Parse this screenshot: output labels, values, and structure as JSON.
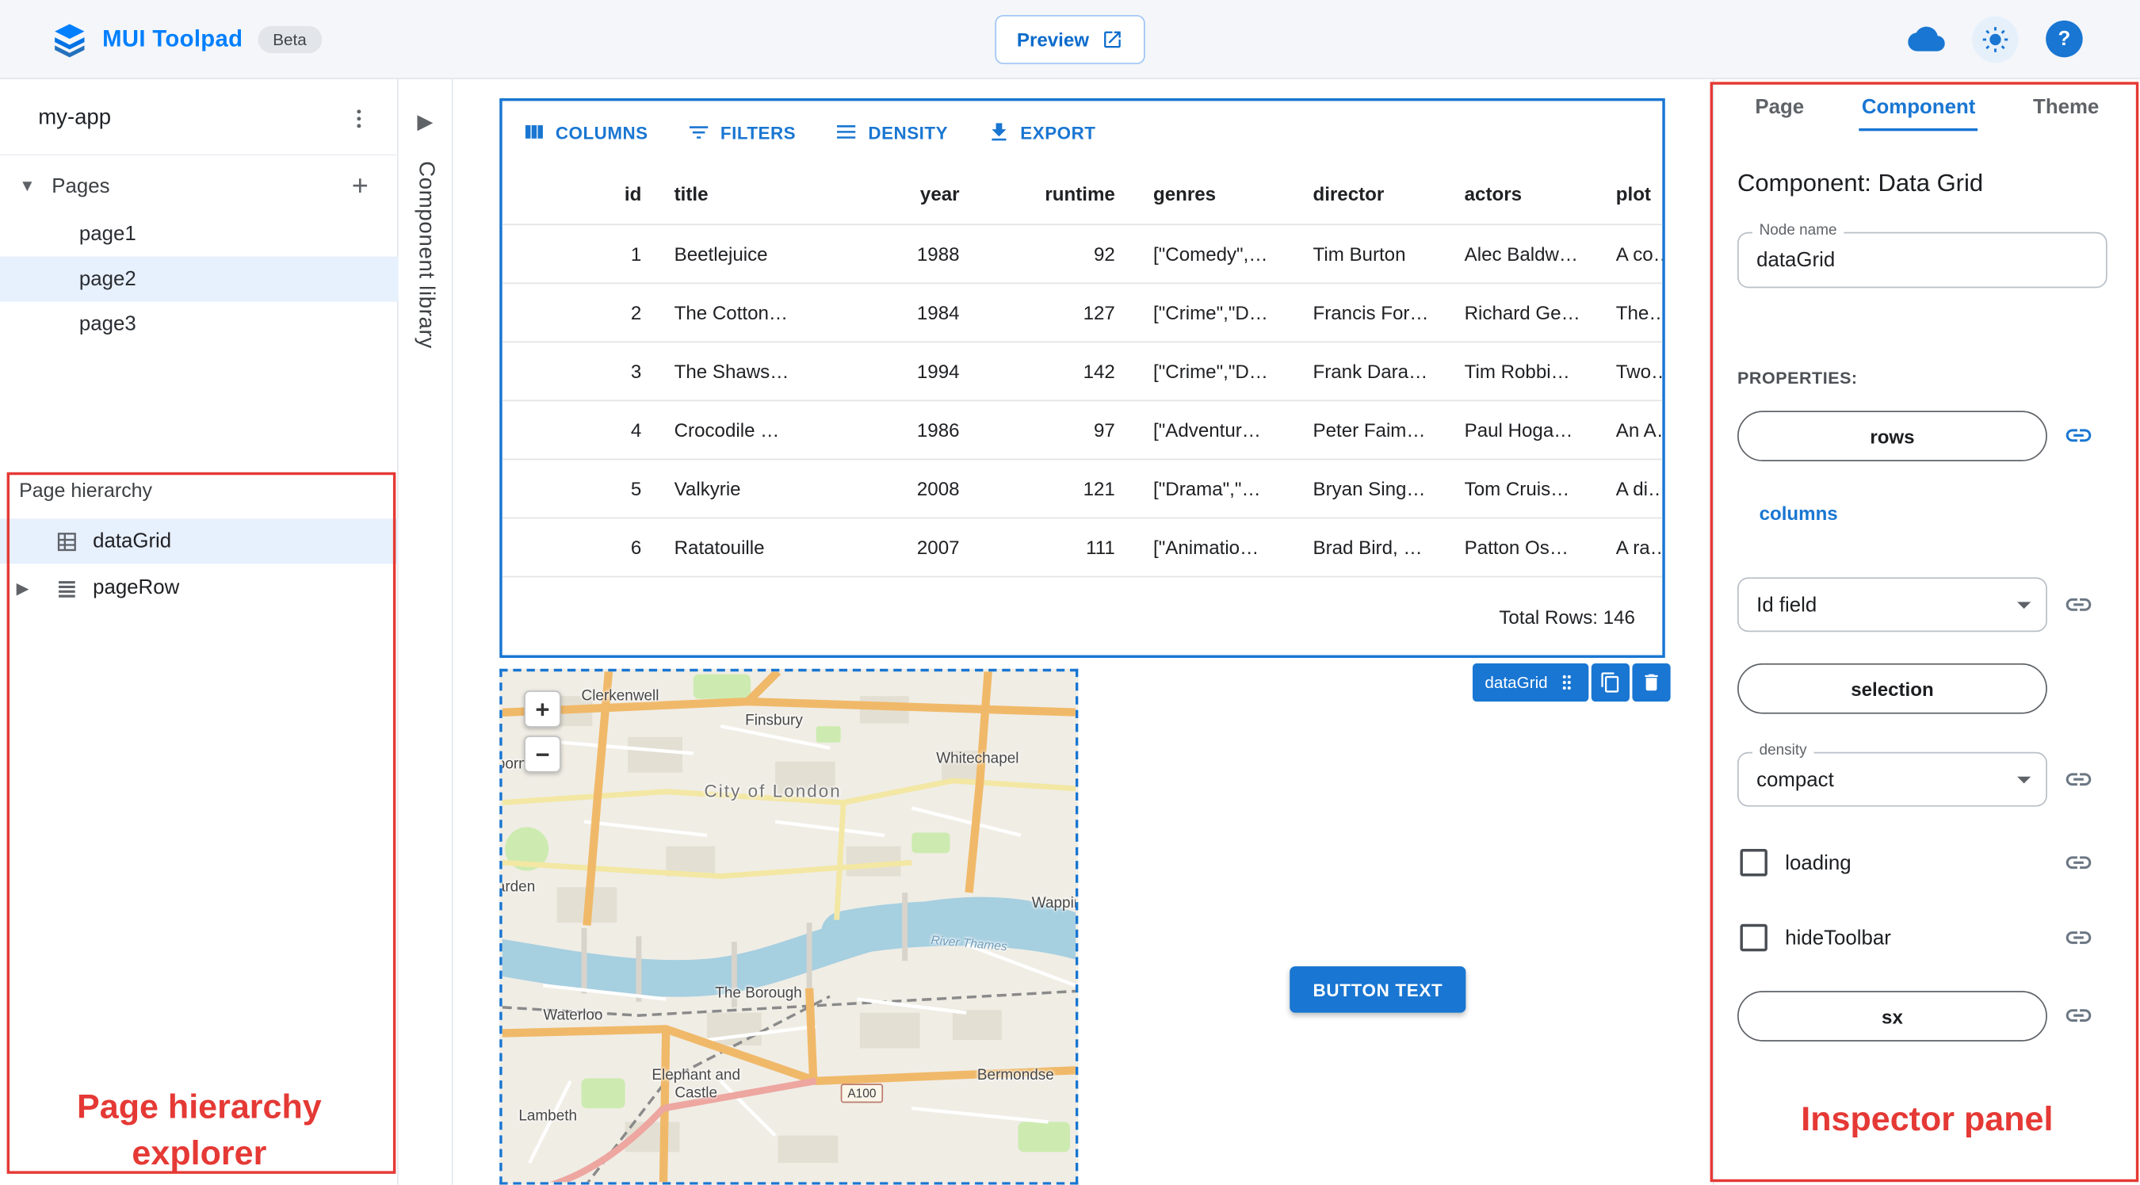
{
  "app_bar": {
    "title": "MUI Toolpad",
    "beta_badge": "Beta",
    "preview_button": "Preview"
  },
  "sidebar": {
    "app_name": "my-app",
    "pages_label": "Pages",
    "pages": [
      {
        "label": "page1"
      },
      {
        "label": "page2"
      },
      {
        "label": "page3"
      }
    ],
    "hierarchy": {
      "title": "Page hierarchy",
      "items": [
        {
          "label": "dataGrid"
        },
        {
          "label": "pageRow"
        }
      ]
    },
    "annotation": "Page hierarchy explorer"
  },
  "component_library": {
    "label": "Component library"
  },
  "canvas": {
    "datagrid": {
      "toolbar": {
        "columns": "COLUMNS",
        "filters": "FILTERS",
        "density": "DENSITY",
        "export": "EXPORT"
      },
      "headers": [
        "id",
        "title",
        "year",
        "runtime",
        "genres",
        "director",
        "actors",
        "plot"
      ],
      "rows": [
        [
          "1",
          "Beetlejuice",
          "1988",
          "92",
          "[\"Comedy\",…",
          "Tim Burton",
          "Alec Baldw…",
          "A co…"
        ],
        [
          "2",
          "The Cotton…",
          "1984",
          "127",
          "[\"Crime\",\"D…",
          "Francis For…",
          "Richard Ge…",
          "The…"
        ],
        [
          "3",
          "The Shaws…",
          "1994",
          "142",
          "[\"Crime\",\"D…",
          "Frank Dara…",
          "Tim Robbi…",
          "Two…"
        ],
        [
          "4",
          "Crocodile …",
          "1986",
          "97",
          "[\"Adventur…",
          "Peter Faim…",
          "Paul Hoga…",
          "An A…"
        ],
        [
          "5",
          "Valkyrie",
          "2008",
          "121",
          "[\"Drama\",\"…",
          "Bryan Sing…",
          "Tom Cruis…",
          "A di…"
        ],
        [
          "6",
          "Ratatouille",
          "2007",
          "111",
          "[\"Animatio…",
          "Brad Bird, …",
          "Patton Os…",
          "A ra…"
        ]
      ],
      "footer": "Total Rows: 146",
      "selection_tag": "dataGrid"
    },
    "map": {
      "zoom_in": "+",
      "zoom_out": "−",
      "road_badge": "A100",
      "labels": [
        {
          "text": "Clerkenwell"
        },
        {
          "text": "Finsbury"
        },
        {
          "text": "Whitechapel"
        },
        {
          "text": "City of London"
        },
        {
          "text": "Wapping"
        },
        {
          "text": "The Borough"
        },
        {
          "text": "Waterloo"
        },
        {
          "text": "Lambeth"
        },
        {
          "text": "Elephant and Castle"
        },
        {
          "text": "Bermondse"
        },
        {
          "text": "born"
        },
        {
          "text": "arden"
        },
        {
          "text": "River Thames"
        }
      ]
    },
    "button_label": "BUTTON TEXT"
  },
  "inspector": {
    "tabs": [
      {
        "label": "Page"
      },
      {
        "label": "Component"
      },
      {
        "label": "Theme"
      }
    ],
    "heading": "Component: Data Grid",
    "node_name_label": "Node name",
    "node_name_value": "dataGrid",
    "properties_label": "PROPERTIES:",
    "rows_button": "rows",
    "columns_link": "columns",
    "id_field_select": "Id field",
    "selection_button": "selection",
    "density_label": "density",
    "density_value": "compact",
    "loading_label": "loading",
    "hide_toolbar_label": "hideToolbar",
    "sx_button": "sx",
    "annotation": "Inspector panel"
  },
  "colors": {
    "primary_blue": "#1976d2",
    "brand_blue": "#007FFF",
    "annotation_red": "#e53935",
    "selected_row_bg": "#e7f0fd"
  }
}
